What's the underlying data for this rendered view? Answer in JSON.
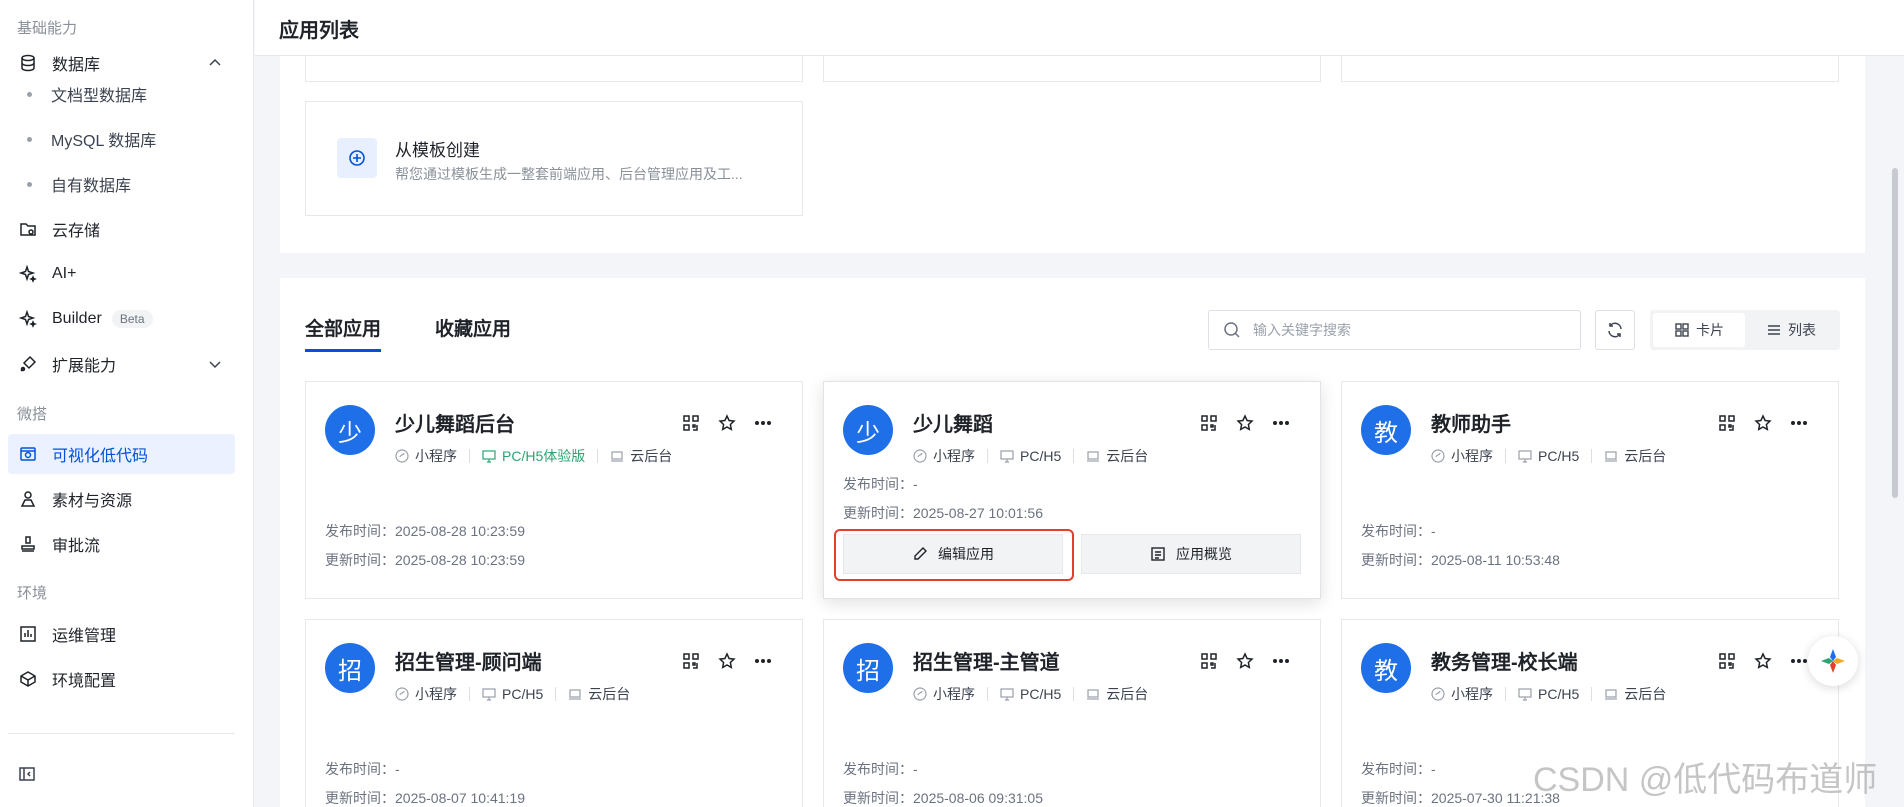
{
  "sidebar": {
    "section1": "基础能力",
    "database": "数据库",
    "db_sub": [
      "文档型数据库",
      "MySQL 数据库",
      "自有数据库"
    ],
    "storage": "云存储",
    "ai": "AI+",
    "builder": "Builder",
    "beta": "Beta",
    "ext": "扩展能力",
    "section2": "微搭",
    "lowcode": "可视化低代码",
    "assets": "素材与资源",
    "approval": "审批流",
    "section3": "环境",
    "ops": "运维管理",
    "env": "环境配置"
  },
  "header": {
    "title": "应用列表"
  },
  "template": {
    "title": "从模板创建",
    "desc": "帮您通过模板生成一整套前端应用、后台管理应用及工..."
  },
  "tabs": {
    "all": "全部应用",
    "fav": "收藏应用"
  },
  "search": {
    "placeholder": "输入关键字搜索"
  },
  "view": {
    "card": "卡片",
    "list": "列表"
  },
  "tag_labels": {
    "mini": "小程序",
    "pch5": "PC/H5",
    "pch5_trial": "PC/H5体验版",
    "cloud": "云后台"
  },
  "labels": {
    "publish": "发布时间：",
    "update": "更新时间："
  },
  "card_buttons": {
    "edit": "编辑应用",
    "overview": "应用概览"
  },
  "cards": [
    {
      "avatar": "少",
      "title": "少儿舞蹈后台",
      "publish": "2025-08-28 10:23:59",
      "update": "2025-08-28 10:23:59"
    },
    {
      "avatar": "少",
      "title": "少儿舞蹈",
      "publish": "-",
      "update": "2025-08-27 10:01:56"
    },
    {
      "avatar": "教",
      "title": "教师助手",
      "publish": "-",
      "update": "2025-08-11 10:53:48"
    },
    {
      "avatar": "招",
      "title": "招生管理-顾问端",
      "publish": "-",
      "update": "2025-08-07 10:41:19"
    },
    {
      "avatar": "招",
      "title": "招生管理-主管道",
      "publish": "-",
      "update": "2025-08-06 09:31:05"
    },
    {
      "avatar": "教",
      "title": "教务管理-校长端",
      "publish": "-",
      "update": "2025-07-30 11:21:38"
    }
  ],
  "watermark": "CSDN @低代码布道师",
  "colors": {
    "primary": "#0052d9",
    "avatar": "#1f6fe8",
    "trial": "#2ba471",
    "highlight": "#e0402c"
  }
}
